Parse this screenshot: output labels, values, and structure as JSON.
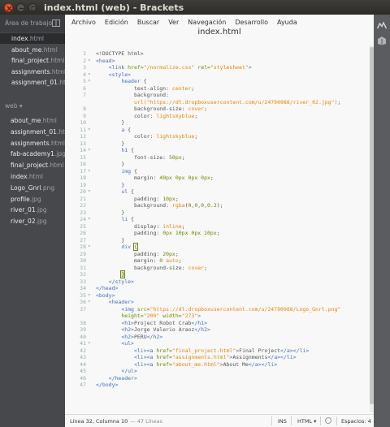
{
  "window": {
    "title": "index.html (web) - Brackets"
  },
  "sidebar": {
    "working_title": "Área de trabajo",
    "working_files": [
      {
        "name": "index.html",
        "selected": true
      },
      {
        "name": "about_me.html",
        "selected": false
      },
      {
        "name": "final_project.html",
        "selected": false
      },
      {
        "name": "assignments.html",
        "selected": false
      },
      {
        "name": "assignment_01.html",
        "selected": false
      }
    ],
    "project_title": "web ▾",
    "project_files": [
      "about_me.html",
      "assignment_01.html",
      "assignments.html",
      "fab-academy1.jpg",
      "final_project.html",
      "index.html",
      "Logo_Gnrl.png",
      "profile.jpg",
      "river_01.jpg",
      "river_02.jpg"
    ]
  },
  "menubar": [
    "Archivo",
    "Edición",
    "Buscar",
    "Ver",
    "Navegación",
    "Desarrollo",
    "Ayuda"
  ],
  "editor": {
    "file_title": "index.html",
    "lines": [
      {
        "n": "1",
        "fold": "",
        "html": "&lt;!DOCTYPE html&gt;"
      },
      {
        "n": "2",
        "fold": "▾",
        "html": "<span class=\"tag\">&lt;head&gt;</span>"
      },
      {
        "n": "3",
        "fold": "",
        "html": "    <span class=\"tag\">&lt;link</span> <span class=\"attr\">href=</span><span class=\"str\">\"/normalize.css\"</span> <span class=\"attr\">rel=</span><span class=\"str\">\"stylesheet\"</span><span class=\"tag\">&gt;</span>"
      },
      {
        "n": "4",
        "fold": "▾",
        "html": "    <span class=\"tag\">&lt;style&gt;</span>"
      },
      {
        "n": "5",
        "fold": "▾",
        "html": "        <span class=\"sel-css\">header</span> {"
      },
      {
        "n": "6",
        "fold": "",
        "html": "            text-align: <span class=\"val\">center</span>;"
      },
      {
        "n": "7",
        "fold": "",
        "html": "            background:"
      },
      {
        "n": "",
        "fold": "",
        "html": "            <span class=\"val\">url(\"https://dl.dropboxusercontent.com/u/24790988/river_02.jpg\")</span>;"
      },
      {
        "n": "8",
        "fold": "",
        "html": "            background-size: <span class=\"val\">cover</span>;"
      },
      {
        "n": "9",
        "fold": "",
        "html": "            color: <span class=\"val\">lightskyblue</span>;"
      },
      {
        "n": "10",
        "fold": "",
        "html": "        }"
      },
      {
        "n": "11",
        "fold": "▾",
        "html": "        <span class=\"sel-css\">a</span> {"
      },
      {
        "n": "12",
        "fold": "",
        "html": "            color: <span class=\"val\">lightskyblue</span>;"
      },
      {
        "n": "13",
        "fold": "",
        "html": "        }"
      },
      {
        "n": "14",
        "fold": "▾",
        "html": "        <span class=\"sel-css\">h1</span> {"
      },
      {
        "n": "15",
        "fold": "",
        "html": "            font-size: <span class=\"num\">50px</span>;"
      },
      {
        "n": "16",
        "fold": "",
        "html": "        }"
      },
      {
        "n": "17",
        "fold": "▾",
        "html": "        <span class=\"sel-css\">img</span> {"
      },
      {
        "n": "18",
        "fold": "",
        "html": "            margin: <span class=\"num\">40px 0px 0px 0px</span>;"
      },
      {
        "n": "19",
        "fold": "",
        "html": "        }"
      },
      {
        "n": "20",
        "fold": "▾",
        "html": "        <span class=\"sel-css\">ul</span> {"
      },
      {
        "n": "21",
        "fold": "",
        "html": "            padding: <span class=\"num\">10px</span>;"
      },
      {
        "n": "22",
        "fold": "",
        "html": "            background: <span class=\"val\">rgba</span>(<span class=\"num\">0,0,0,0.3</span>);"
      },
      {
        "n": "23",
        "fold": "",
        "html": "        }"
      },
      {
        "n": "24",
        "fold": "▾",
        "html": "        <span class=\"sel-css\">li</span> {"
      },
      {
        "n": "25",
        "fold": "",
        "html": "            display: <span class=\"val\">inline</span>;"
      },
      {
        "n": "26",
        "fold": "",
        "html": "            padding: <span class=\"num\">0px 10px 0px 10px</span>;"
      },
      {
        "n": "27",
        "fold": "",
        "html": "        }"
      },
      {
        "n": "28",
        "fold": "▾",
        "html": "        <span class=\"sel-css\">div</span> <span class=\"bracket\">{</span>"
      },
      {
        "n": "29",
        "fold": "",
        "html": "            padding: <span class=\"num\">20px</span>;"
      },
      {
        "n": "30",
        "fold": "",
        "html": "            margin: <span class=\"num\">0</span> <span class=\"val\">auto</span>;"
      },
      {
        "n": "31",
        "fold": "",
        "html": "            background-size: <span class=\"val\">cover</span>;"
      },
      {
        "n": "32",
        "fold": "",
        "html": "        <span class=\"bracket cursor-mark\">}</span>"
      },
      {
        "n": "33",
        "fold": "",
        "html": "    <span class=\"tag\">&lt;/style&gt;</span>"
      },
      {
        "n": "34",
        "fold": "",
        "html": "<span class=\"tag\">&lt;/head&gt;</span>"
      },
      {
        "n": "35",
        "fold": "▾",
        "html": "<span class=\"tag\">&lt;body&gt;</span>"
      },
      {
        "n": "36",
        "fold": "▾",
        "html": "    <span class=\"tag\">&lt;header&gt;</span>"
      },
      {
        "n": "37",
        "fold": "",
        "html": "        <span class=\"tag\">&lt;img</span> <span class=\"attr\">src=</span><span class=\"str\">\"https://dl.dropboxusercontent.com/u/24790988/Logo_Gnrl.png\"</span>"
      },
      {
        "n": "",
        "fold": "",
        "html": "        <span class=\"attr\">height=</span><span class=\"str\">\"200\"</span> <span class=\"attr\">width=</span><span class=\"str\">\"273\"</span><span class=\"tag\">&gt;</span>"
      },
      {
        "n": "38",
        "fold": "",
        "html": "        <span class=\"tag\">&lt;h1&gt;</span>Project Robot Crab<span class=\"tag\">&lt;/h1&gt;</span>"
      },
      {
        "n": "39",
        "fold": "",
        "html": "        <span class=\"tag\">&lt;h2&gt;</span>Jorge Valerio Araoz<span class=\"tag\">&lt;/h2&gt;</span>"
      },
      {
        "n": "40",
        "fold": "",
        "html": "        <span class=\"tag\">&lt;h2&gt;</span>PERU<span class=\"tag\">&lt;/h2&gt;</span>"
      },
      {
        "n": "41",
        "fold": "▾",
        "html": "        <span class=\"tag\">&lt;ul&gt;</span>"
      },
      {
        "n": "42",
        "fold": "",
        "html": "            <span class=\"tag\">&lt;li&gt;&lt;a</span> <span class=\"attr\">href=</span><span class=\"str\">\"final_project.html\"</span><span class=\"tag\">&gt;</span>Final Project<span class=\"tag\">&lt;/a&gt;&lt;/li&gt;</span>"
      },
      {
        "n": "43",
        "fold": "",
        "html": "            <span class=\"tag\">&lt;li&gt;&lt;a</span> <span class=\"attr\">href=</span><span class=\"str\">\"assignments.html\"</span><span class=\"tag\">&gt;</span>Assignments<span class=\"tag\">&lt;/a&gt;&lt;/li&gt;</span>"
      },
      {
        "n": "44",
        "fold": "",
        "html": "            <span class=\"tag\">&lt;li&gt;&lt;a</span> <span class=\"attr\">href=</span><span class=\"str\">\"about_me.html\"</span><span class=\"tag\">&gt;</span>About Me<span class=\"tag\">&lt;/a&gt;&lt;/li&gt;</span>"
      },
      {
        "n": "45",
        "fold": "",
        "html": "        <span class=\"tag\">&lt;/ul&gt;</span>"
      },
      {
        "n": "46",
        "fold": "",
        "html": "    <span class=\"tag\">&lt;/header&gt;</span>"
      },
      {
        "n": "47",
        "fold": "",
        "html": "<span class=\"tag\">&lt;/body&gt;</span>"
      }
    ]
  },
  "statusbar": {
    "cursor": "Línea 32, Columna 10",
    "lines": "— 47 Líneas",
    "mode": "INS",
    "language": "HTML ▾",
    "indent": "Espacios: 4"
  }
}
